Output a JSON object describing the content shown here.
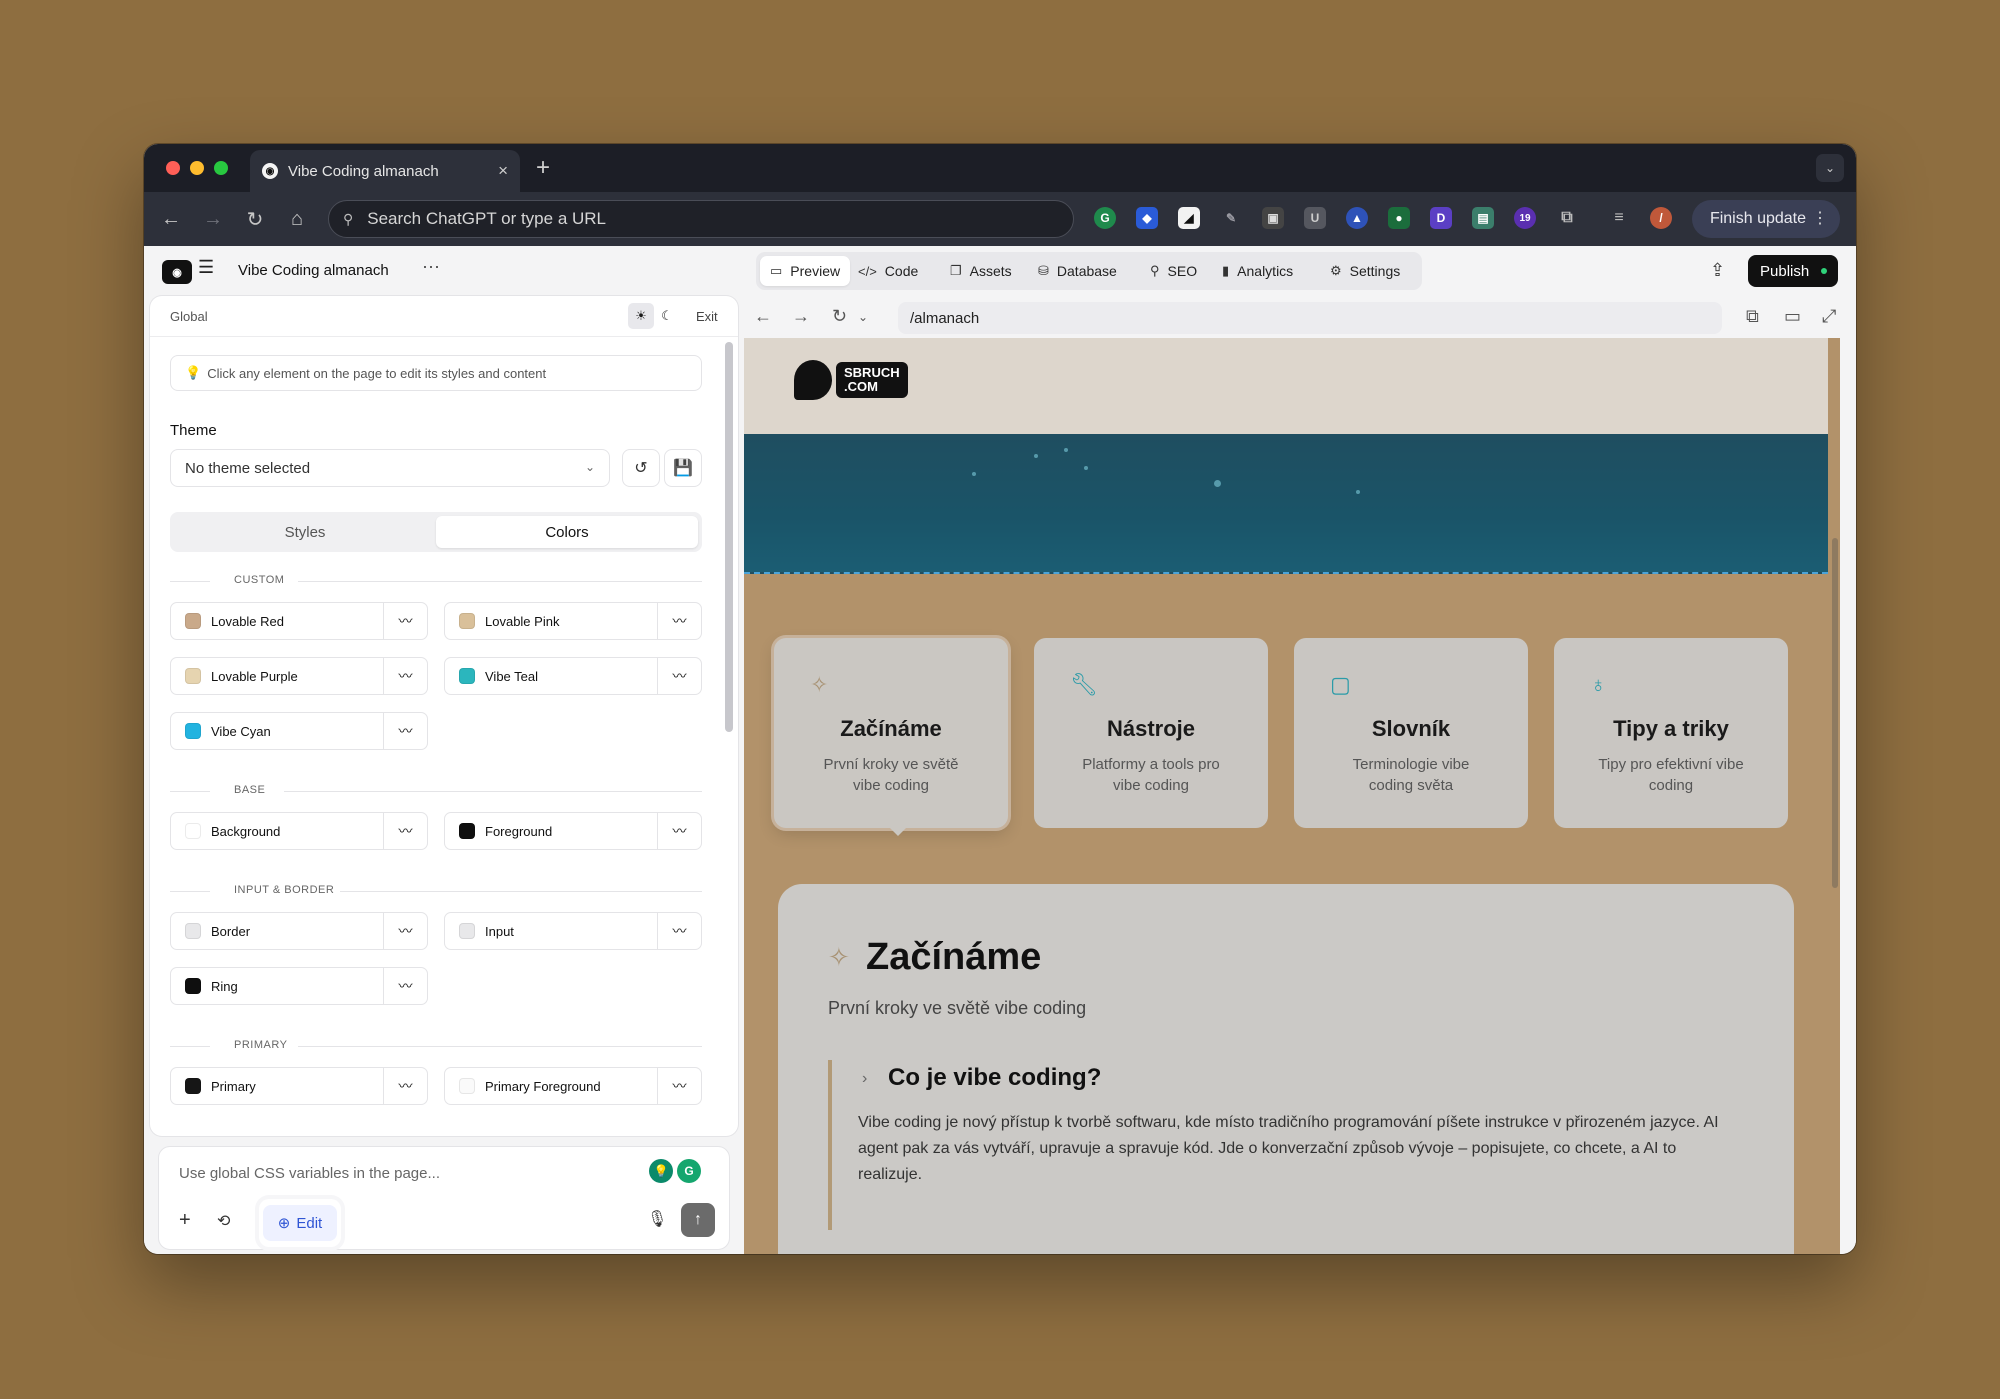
{
  "browser": {
    "tab_title": "Vibe Coding almanach",
    "tab_close": "×",
    "new_tab": "+",
    "address_placeholder": "Search ChatGPT or type a URL",
    "finish_update": "Finish update",
    "ext_badge_count": "19"
  },
  "app": {
    "project_title": "Vibe Coding almanach",
    "more": "···"
  },
  "panel": {
    "scope": "Global",
    "exit": "Exit",
    "hint": "Click any element on the page to edit its styles and content",
    "theme_label": "Theme",
    "theme_value": "No theme selected",
    "tabs": [
      "Styles",
      "Colors"
    ],
    "active_tab": "Colors",
    "sections": {
      "custom": "CUSTOM",
      "base": "BASE",
      "input_border": "INPUT & BORDER",
      "primary": "PRIMARY"
    },
    "colors": {
      "lovable_red": {
        "name": "Lovable Red",
        "swatch": "#C9A98A"
      },
      "lovable_pink": {
        "name": "Lovable Pink",
        "swatch": "#D9C09A"
      },
      "lovable_purple": {
        "name": "Lovable Purple",
        "swatch": "#E6D4B0"
      },
      "vibe_teal": {
        "name": "Vibe Teal",
        "swatch": "#2BB6BD"
      },
      "vibe_cyan": {
        "name": "Vibe Cyan",
        "swatch": "#22B3E0"
      },
      "background": {
        "name": "Background",
        "swatch": "#FFFFFF"
      },
      "foreground": {
        "name": "Foreground",
        "swatch": "#0F0F0F"
      },
      "border": {
        "name": "Border",
        "swatch": "#E8E8EA"
      },
      "input": {
        "name": "Input",
        "swatch": "#E8E8EA"
      },
      "ring": {
        "name": "Ring",
        "swatch": "#0F0F0F"
      },
      "primary": {
        "name": "Primary",
        "swatch": "#161616"
      },
      "primary_foreground": {
        "name": "Primary Foreground",
        "swatch": "#FAFAFA"
      }
    }
  },
  "composer": {
    "placeholder": "Use global CSS variables in the page...",
    "edit_label": "Edit"
  },
  "preview": {
    "tabs": [
      {
        "label": "Preview",
        "icon": "layout-icon"
      },
      {
        "label": "Code",
        "icon": "code-icon"
      },
      {
        "label": "Assets",
        "icon": "copy-icon"
      },
      {
        "label": "Database",
        "icon": "database-icon"
      },
      {
        "label": "SEO",
        "icon": "search-icon"
      },
      {
        "label": "Analytics",
        "icon": "bar-chart-icon"
      },
      {
        "label": "Settings",
        "icon": "gear-icon"
      }
    ],
    "publish": "Publish",
    "path": "/almanach"
  },
  "site": {
    "brand_line1": "SBRUCH",
    "brand_line2": ".COM",
    "cards": [
      {
        "title": "Začínáme",
        "desc": "První kroky ve světě vibe coding",
        "icon": "sparkles-icon"
      },
      {
        "title": "Nástroje",
        "desc": "Platformy a tools pro vibe coding",
        "icon": "wrench-icon"
      },
      {
        "title": "Slovník",
        "desc": "Terminologie vibe coding světa",
        "icon": "book-icon"
      },
      {
        "title": "Tipy a triky",
        "desc": "Tipy pro efektivní vibe coding",
        "icon": "lightbulb-icon"
      }
    ],
    "section_title": "Začínáme",
    "section_subtitle": "První kroky ve světě vibe coding",
    "question": "Co je vibe coding?",
    "answer": "Vibe coding je nový přístup k tvorbě softwaru, kde místo tradičního programování píšete instrukce v přirozeném jazyce. AI agent pak za vás vytváří, upravuje a spravuje kód. Jde o konverzační způsob vývoje – popisujete, co chcete, a AI to realizuje."
  },
  "accent_colors": {
    "teal": "#2B9BA8",
    "publish_dot": "#2FD37A",
    "edit_blue": "#2F55D4"
  }
}
